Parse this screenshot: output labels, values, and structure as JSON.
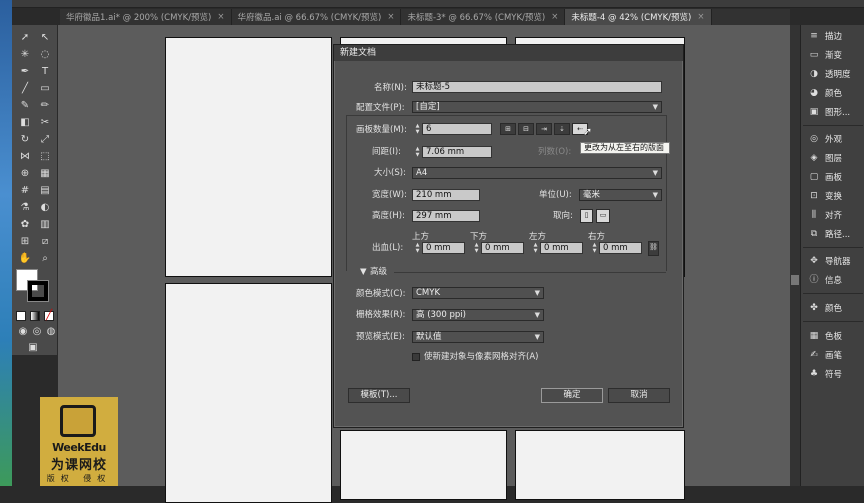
{
  "tabs": [
    {
      "label": "华府徽品1.ai* @ 200% (CMYK/预览)",
      "close": "×"
    },
    {
      "label": "华府徽品.ai @ 66.67% (CMYK/预览)",
      "close": "×"
    },
    {
      "label": "未标题-3* @ 66.67% (CMYK/预览)",
      "close": "×"
    },
    {
      "label": "未标题-4 @ 42% (CMYK/预览)",
      "close": "×"
    }
  ],
  "dialog": {
    "title": "新建文档",
    "name_label": "名称(N):",
    "name_value": "未标题-5",
    "profile_label": "配置文件(P):",
    "profile_value": "[自定]",
    "artboards_label": "画板数量(M):",
    "artboards_value": "6",
    "spacing_label": "间距(I):",
    "spacing_value": "7.06 mm",
    "columns_label": "列数(O):",
    "size_label": "大小(S):",
    "size_value": "A4",
    "width_label": "宽度(W):",
    "width_value": "210 mm",
    "units_label": "单位(U):",
    "units_value": "毫米",
    "height_label": "高度(H):",
    "height_value": "297 mm",
    "orientation_label": "取向:",
    "bleed_label": "出血(L):",
    "bleed_top_label": "上方",
    "bleed_top": "0 mm",
    "bleed_bottom_label": "下方",
    "bleed_bottom": "0 mm",
    "bleed_left_label": "左方",
    "bleed_left": "0 mm",
    "bleed_right_label": "右方",
    "bleed_right": "0 mm",
    "advanced_label": "高级",
    "color_mode_label": "颜色模式(C):",
    "color_mode_value": "CMYK",
    "raster_label": "栅格效果(R):",
    "raster_value": "高 (300 ppi)",
    "preview_label": "预览模式(E):",
    "preview_value": "默认值",
    "align_pixel_label": "使新建对象与像素网格对齐(A)",
    "template_button": "模板(T)...",
    "ok_button": "确定",
    "cancel_button": "取消",
    "tooltip": "更改为从左至右的版面"
  },
  "right_panel": [
    {
      "label": "描边",
      "icon": "stroke-icon"
    },
    {
      "label": "渐变",
      "icon": "gradient-icon"
    },
    {
      "label": "透明度",
      "icon": "transparency-icon"
    },
    {
      "label": "颜色",
      "icon": "color-icon"
    },
    {
      "label": "图形...",
      "icon": "graphic-styles-icon"
    },
    {
      "label": "外观",
      "icon": "appearance-icon"
    },
    {
      "label": "图层",
      "icon": "layers-icon"
    },
    {
      "label": "画板",
      "icon": "artboards-icon"
    },
    {
      "label": "变换",
      "icon": "transform-icon"
    },
    {
      "label": "对齐",
      "icon": "align-icon"
    },
    {
      "label": "路径...",
      "icon": "pathfinder-icon"
    },
    {
      "label": "导航器",
      "icon": "navigator-icon"
    },
    {
      "label": "信息",
      "icon": "info-icon"
    },
    {
      "label": "颜色",
      "icon": "color-guide-icon"
    },
    {
      "label": "色板",
      "icon": "swatches-icon"
    },
    {
      "label": "画笔",
      "icon": "brushes-icon"
    },
    {
      "label": "符号",
      "icon": "symbols-icon"
    }
  ],
  "logo": {
    "brand": "WeekEdu",
    "cn": "为课网校",
    "sub": "版权 侵权"
  }
}
